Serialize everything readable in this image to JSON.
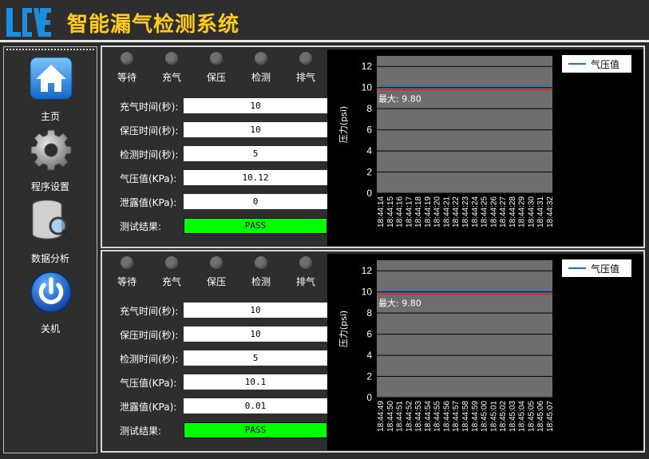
{
  "header": {
    "logo_text": "LCAE",
    "title": "智能漏气检测系统"
  },
  "sidebar": {
    "items": [
      {
        "label": "主页",
        "icon": "home-icon"
      },
      {
        "label": "程序设置",
        "icon": "gear-icon"
      },
      {
        "label": "数据分析",
        "icon": "database-search-icon"
      },
      {
        "label": "关机",
        "icon": "power-icon"
      }
    ]
  },
  "panels": [
    {
      "stages": [
        "等待",
        "充气",
        "保压",
        "检测",
        "排气"
      ],
      "fields": [
        {
          "label": "充气时间(秒):",
          "value": "10"
        },
        {
          "label": "保压时间(秒):",
          "value": "10"
        },
        {
          "label": "检测时间(秒):",
          "value": "5"
        },
        {
          "label": "气压值(KPa):",
          "value": "10.12"
        },
        {
          "label": "泄露值(KPa):",
          "value": "0"
        }
      ],
      "result_label": "测试结果:",
      "result_value": "PASS",
      "result_color": "#00ff00",
      "chart_data": {
        "type": "line",
        "ylabel": "压力(psi)",
        "ylim": [
          0,
          13
        ],
        "yticks": [
          0,
          2,
          4,
          6,
          8,
          10,
          12
        ],
        "x": [
          "18:44:14",
          "18:44:15",
          "18:44:16",
          "18:44:17",
          "18:44:18",
          "18:44:19",
          "18:44:20",
          "18:44:21",
          "18:44:22",
          "18:44:23",
          "18:44:24",
          "18:44:25",
          "18:44:26",
          "18:44:27",
          "18:44:28",
          "18:44:29",
          "18:44:30",
          "18:44:31",
          "18:44:32"
        ],
        "series": [
          {
            "name": "气压值",
            "color": "#1e6fe0",
            "values": [
              10.12,
              10.12,
              10.12,
              10.12,
              10.12,
              10.12,
              10.12,
              10.12,
              10.12,
              10.12,
              10.12,
              10.12,
              10.12,
              10.12,
              10.12,
              10.12,
              10.12,
              10.12,
              10.12
            ]
          }
        ],
        "max_line": {
          "value": 9.8,
          "label": "最大: 9.80",
          "color": "#e02020"
        }
      }
    },
    {
      "stages": [
        "等待",
        "充气",
        "保压",
        "检测",
        "排气"
      ],
      "fields": [
        {
          "label": "充气时间(秒):",
          "value": "10"
        },
        {
          "label": "保压时间(秒):",
          "value": "10"
        },
        {
          "label": "检测时间(秒):",
          "value": "5"
        },
        {
          "label": "气压值(KPa):",
          "value": "10.1"
        },
        {
          "label": "泄露值(KPa):",
          "value": "0.01"
        }
      ],
      "result_label": "测试结果:",
      "result_value": "PASS",
      "result_color": "#00ff00",
      "chart_data": {
        "type": "line",
        "ylabel": "压力(psi)",
        "ylim": [
          0,
          13
        ],
        "yticks": [
          0,
          2,
          4,
          6,
          8,
          10,
          12
        ],
        "x": [
          "18:44:49",
          "18:44:50",
          "18:44:51",
          "18:44:52",
          "18:44:53",
          "18:44:54",
          "18:44:55",
          "18:44:56",
          "18:44:57",
          "18:44:58",
          "18:44:59",
          "18:45:00",
          "18:45:01",
          "18:45:02",
          "18:45:03",
          "18:45:04",
          "18:45:05",
          "18:45:06",
          "18:45:07"
        ],
        "series": [
          {
            "name": "气压值",
            "color": "#1e6fe0",
            "values": [
              10.1,
              10.1,
              10.1,
              10.1,
              10.1,
              10.1,
              10.1,
              10.1,
              10.1,
              10.1,
              10.1,
              10.1,
              10.1,
              10.1,
              10.1,
              10.1,
              10.1,
              10.1,
              10.1
            ]
          }
        ],
        "max_line": {
          "value": 9.8,
          "label": "最大: 9.80",
          "color": "#e02020"
        }
      }
    }
  ]
}
